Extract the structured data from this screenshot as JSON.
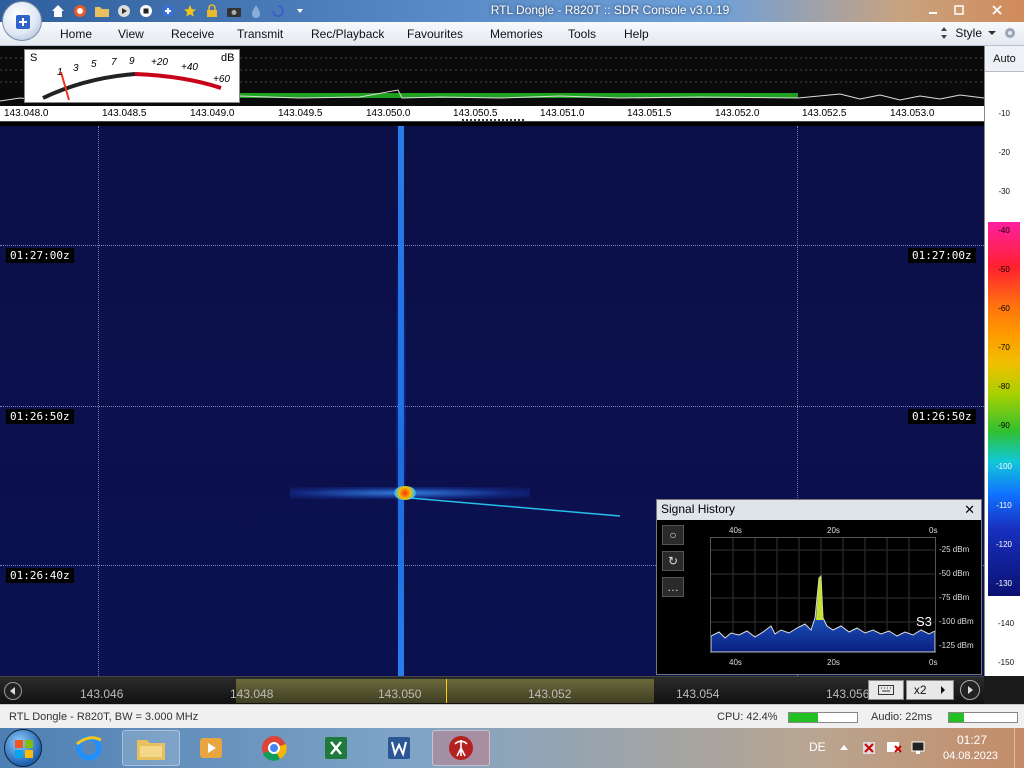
{
  "window": {
    "title": "RTL Dongle - R820T :: SDR Console v3.0.19"
  },
  "menu": {
    "items": [
      "Home",
      "View",
      "Receive",
      "Transmit",
      "Rec/Playback",
      "Favourites",
      "Memories",
      "Tools",
      "Help"
    ],
    "style_label": "Style"
  },
  "smeter": {
    "s_label": "S",
    "db_label": "dB",
    "scale": [
      "1",
      "3",
      "5",
      "7",
      "9",
      "+20",
      "+40",
      "+60"
    ]
  },
  "right_panel": {
    "auto_label": "Auto",
    "db_ticks": [
      "-10",
      "-20",
      "-30",
      "-40",
      "-50",
      "-60",
      "-70",
      "-80",
      "-90",
      "-100",
      "-110",
      "-120",
      "-130",
      "-140",
      "-150"
    ]
  },
  "freq_scale": {
    "ticks": [
      "143.048.0",
      "143.048.5",
      "143.049.0",
      "143.049.5",
      "143.050.0",
      "143.050.5",
      "143.051.0",
      "143.051.5",
      "143.052.0",
      "143.052.5",
      "143.053.0"
    ]
  },
  "waterfall": {
    "timestamps": [
      "01:27:00z",
      "01:26:50z",
      "01:26:40z"
    ]
  },
  "signal_history": {
    "title": "Signal History",
    "x_labels": [
      "40s",
      "20s",
      "0s"
    ],
    "y_labels": [
      "-25 dBm",
      "-50 dBm",
      "-75 dBm",
      "-100 dBm",
      "-125 dBm"
    ],
    "s_value": "S3"
  },
  "tuning_bar": {
    "freqs": [
      "143.046",
      "143.048",
      "143.050",
      "143.052",
      "143.054",
      "143.056"
    ],
    "zoom_label": "x2"
  },
  "status": {
    "device": "RTL Dongle - R820T, BW = 3.000 MHz",
    "cpu": "CPU: 42.4%",
    "cpu_level": 0.42,
    "audio": "Audio: 22ms",
    "audio_level": 0.22
  },
  "taskbar": {
    "lang": "DE",
    "time": "01:27",
    "date": "04.08.2023"
  }
}
